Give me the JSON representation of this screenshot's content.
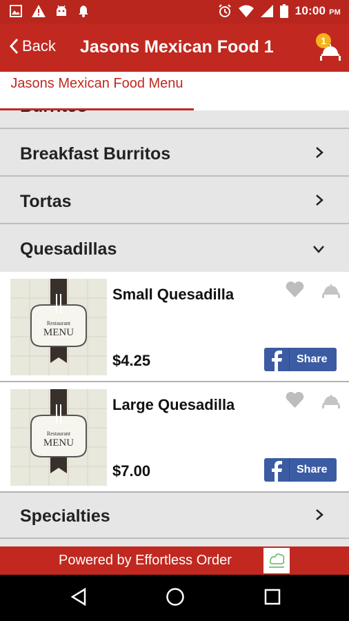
{
  "status_bar": {
    "time": "10:00",
    "ampm": "PM"
  },
  "header": {
    "back_label": "Back",
    "title": "Jasons Mexican Food 1",
    "cart_count": "1"
  },
  "tabs": [
    {
      "label": "Jasons Mexican Food Menu",
      "active": true
    }
  ],
  "categories": [
    {
      "label": "Burritos",
      "expanded": false
    },
    {
      "label": "Breakfast Burritos",
      "expanded": false
    },
    {
      "label": "Tortas",
      "expanded": false
    },
    {
      "label": "Quesadillas",
      "expanded": true
    },
    {
      "label": "Specialties",
      "expanded": false
    }
  ],
  "items": [
    {
      "name": "Small Quesadilla",
      "price": "$4.25",
      "share_label": "Share",
      "thumb_text": [
        "Restaurant",
        "MENU"
      ]
    },
    {
      "name": "Large Quesadilla",
      "price": "$7.00",
      "share_label": "Share",
      "thumb_text": [
        "Restaurant",
        "MENU"
      ]
    }
  ],
  "footer": {
    "text": "Powered by Effortless Order",
    "logo_text": "Effortless Order"
  },
  "colors": {
    "brand_red": "#c1281f",
    "badge": "#f5b21a",
    "facebook": "#3b5ba3"
  }
}
